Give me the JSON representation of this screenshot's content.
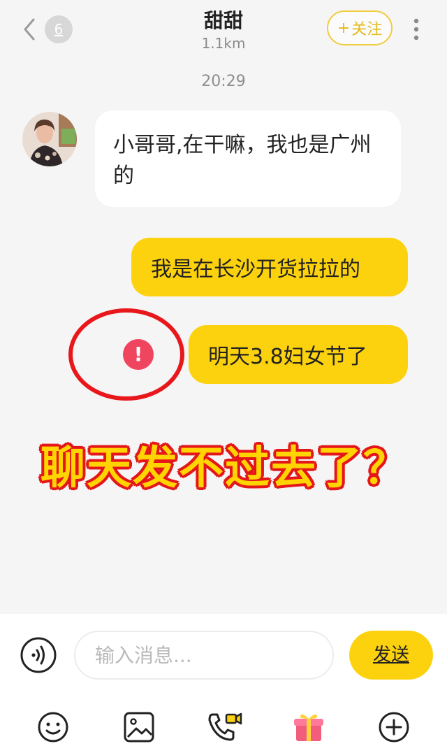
{
  "header": {
    "unread_count": "6",
    "title": "甜甜",
    "distance": "1.1km",
    "follow_label": "关注",
    "follow_plus": "+"
  },
  "chat": {
    "timestamp": "20:29",
    "messages": [
      {
        "side": "incoming",
        "text": "小哥哥,在干嘛，我也是广州的"
      },
      {
        "side": "outgoing",
        "text": "我是在长沙开货拉拉的"
      },
      {
        "side": "outgoing",
        "text": "明天3.8妇女节了",
        "status": "failed",
        "status_icon": "!"
      }
    ]
  },
  "overlay": {
    "caption": "聊天发不过去了？",
    "caption_color": "#ffd400",
    "outline_color": "#e4161a"
  },
  "input_bar": {
    "placeholder": "输入消息...",
    "send_label": "发送"
  },
  "toolbar": {
    "icons": [
      "emoji-icon",
      "image-icon",
      "video-call-icon",
      "gift-icon",
      "add-icon"
    ]
  },
  "colors": {
    "accent": "#fcd20f",
    "error": "#f0455e",
    "background": "#f5f5f5"
  }
}
